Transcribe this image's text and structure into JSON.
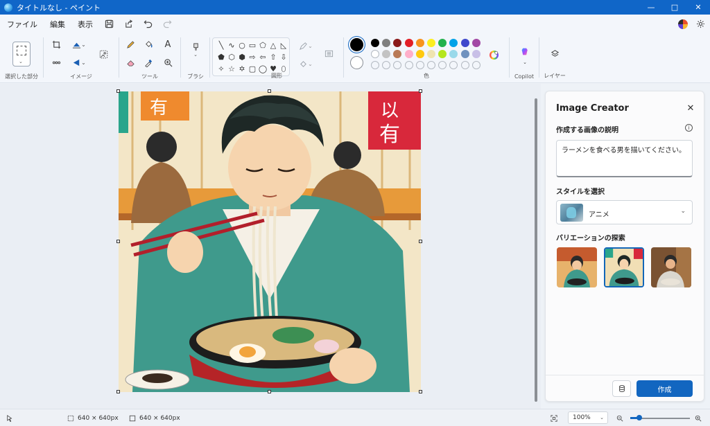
{
  "window": {
    "title": "タイトルなし - ペイント"
  },
  "menu": {
    "file": "ファイル",
    "edit": "編集",
    "view": "表示"
  },
  "ribbon": {
    "groups": {
      "selection": "選択した部分",
      "image": "イメージ",
      "tools": "ツール",
      "brush": "ブラシ",
      "shapes": "図形",
      "colors": "色",
      "copilot": "Copilot",
      "layers": "レイヤー"
    },
    "shapes": [
      "╲",
      "∿",
      "○",
      "▭",
      "⬠",
      "△",
      "◺",
      "⬟",
      "⬡",
      "⬢",
      "⇨",
      "⇦",
      "⇧",
      "⇩",
      "✧",
      "☆",
      "✡",
      "▢",
      "◯",
      "♥",
      "⬯"
    ],
    "current_colors": {
      "primary": "#000000",
      "secondary": "#ffffff"
    },
    "palette_row1": [
      "#000000",
      "#7f7f7f",
      "#8b1a1a",
      "#e21f26",
      "#f7931e",
      "#fcee21",
      "#22b14c",
      "#00a2e8",
      "#3f48cc",
      "#a349a4"
    ],
    "palette_row2": [
      "#ffffff",
      "#c3c3c3",
      "#b97a57",
      "#ffaec9",
      "#ffc90e",
      "#efe4b0",
      "#b5e61d",
      "#99d9ea",
      "#7092be",
      "#c8bfe7"
    ],
    "palette_row3_empty": 10
  },
  "panel": {
    "title": "Image Creator",
    "desc_label": "作成する画像の説明",
    "prompt": "ラーメンを食べる男を描いてください。",
    "style_label": "スタイルを選択",
    "style_value": "アニメ",
    "variations_label": "バリエーションの探索",
    "create_label": "作成"
  },
  "status": {
    "selection_size": "640 × 640px",
    "canvas_size": "640 × 640px",
    "zoom": "100%",
    "zoom_slider_fraction": 0.15
  }
}
